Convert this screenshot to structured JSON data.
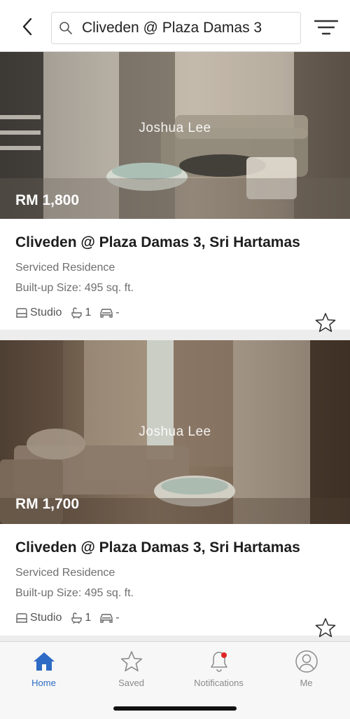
{
  "search": {
    "value": "Cliveden @ Plaza Damas 3"
  },
  "listings": [
    {
      "price": "RM 1,800",
      "watermark": "Joshua Lee",
      "title": "Cliveden @ Plaza Damas 3, Sri Hartamas",
      "property_type": "Serviced Residence",
      "built_up": "Built-up Size: 495 sq. ft.",
      "bedrooms": "Studio",
      "bathrooms": "1",
      "parking": "-"
    },
    {
      "price": "RM 1,700",
      "watermark": "Joshua Lee",
      "title": "Cliveden @ Plaza Damas 3, Sri Hartamas",
      "property_type": "Serviced Residence",
      "built_up": "Built-up Size: 495 sq. ft.",
      "bedrooms": "Studio",
      "bathrooms": "1",
      "parking": "-"
    }
  ],
  "tabs": [
    {
      "label": "Home",
      "icon": "home-icon",
      "active": true
    },
    {
      "label": "Saved",
      "icon": "star-icon",
      "active": false
    },
    {
      "label": "Notifications",
      "icon": "bell-icon",
      "active": false
    },
    {
      "label": "Me",
      "icon": "user-icon",
      "active": false
    }
  ],
  "colors": {
    "accent": "#2d6bc4",
    "notification_dot": "#e02424",
    "tab_inactive": "#8b8b8b"
  }
}
